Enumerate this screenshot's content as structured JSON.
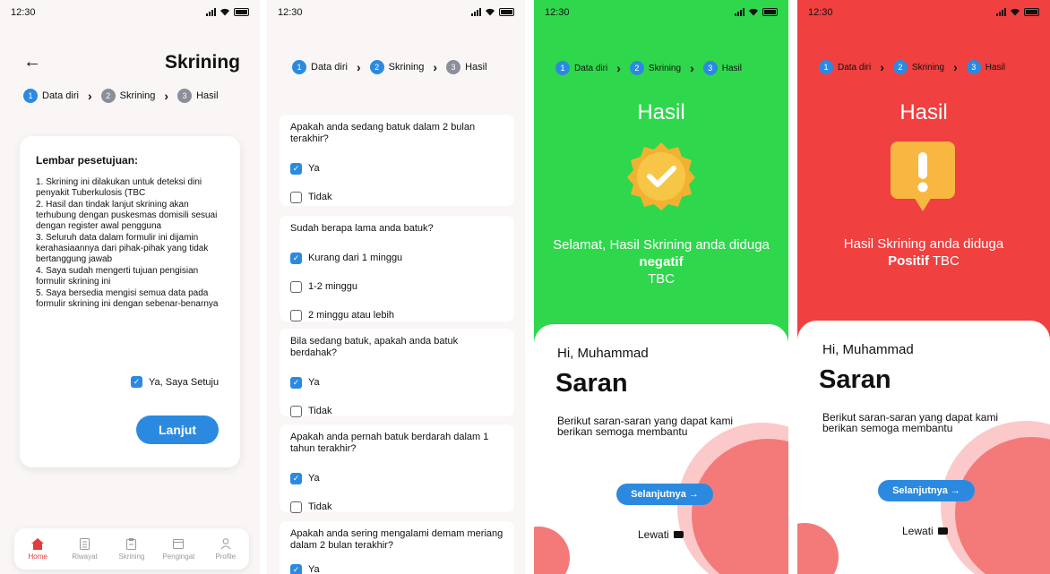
{
  "status": {
    "time": "12:30"
  },
  "stepper": {
    "steps": [
      "Data diri",
      "Skrining",
      "Hasil"
    ],
    "numbers": [
      "1",
      "2",
      "3"
    ]
  },
  "consent_screen": {
    "title": "Skrining",
    "card_title": "Lembar pesetujuan:",
    "terms": [
      "1. Skrining ini dilakukan untuk deteksi dini penyakit Tuberkulosis (TBC",
      "2. Hasil dan tindak lanjut skrining akan terhubung dengan puskesmas domisili sesuai dengan register awal pengguna",
      "3. Seluruh data dalam formulir ini dijamin kerahasiaannya dari pihak-pihak yang tidak bertanggung jawab",
      "4. Saya sudah mengerti tujuan pengisian formulir skrining ini",
      "5. Saya bersedia mengisi semua data pada formulir skrining ini dengan sebenar-benarnya"
    ],
    "agree_label": "Ya, Saya Setuju",
    "button": "Lanjut",
    "nav": [
      "Home",
      "Riwayat",
      "Skrining",
      "Pengingat",
      "Profile"
    ]
  },
  "screening_screen": {
    "questions": [
      {
        "q": "Apakah anda sedang batuk dalam 2 bulan terakhir?",
        "options": [
          "Ya",
          "Tidak"
        ],
        "checked": [
          true,
          false
        ]
      },
      {
        "q": "Sudah berapa lama anda batuk?",
        "options": [
          "Kurang dari 1 minggu",
          "1-2 minggu",
          "2 minggu atau lebih"
        ],
        "checked": [
          true,
          false,
          false
        ]
      },
      {
        "q": "Bila sedang batuk, apakah anda batuk berdahak?",
        "options": [
          "Ya",
          "Tidak"
        ],
        "checked": [
          true,
          false
        ]
      },
      {
        "q": "Apakah anda pernah batuk berdarah dalam 1 tahun terakhir?",
        "options": [
          "Ya",
          "Tidak"
        ],
        "checked": [
          true,
          false
        ]
      },
      {
        "q": "Apakah anda sering mengalami demam meriang dalam 2 bulan terakhir?",
        "options": [
          "Ya"
        ],
        "checked": [
          true
        ]
      }
    ]
  },
  "result_negative": {
    "title": "Hasil",
    "text_before": "Selamat, Hasil Skrining anda diduga",
    "text_bold": "negatif",
    "text_after": "TBC",
    "greeting": "Hi, Muhammad",
    "saran": "Saran",
    "desc": "Berikut saran-saran yang dapat kami berikan semoga membantu",
    "next_button": "Selanjutnya →",
    "skip": "Lewati",
    "bg_color": "#2fd74c"
  },
  "result_positive": {
    "title": "Hasil",
    "text_before": "Hasil Skrining anda diduga",
    "text_bold": "Positif",
    "text_after": "TBC",
    "greeting": "Hi, Muhammad",
    "saran": "Saran",
    "desc": "Berikut saran-saran yang dapat kami berikan semoga membantu",
    "next_button": "Selanjutnya →",
    "skip": "Lewati",
    "bg_color": "#f04040"
  }
}
